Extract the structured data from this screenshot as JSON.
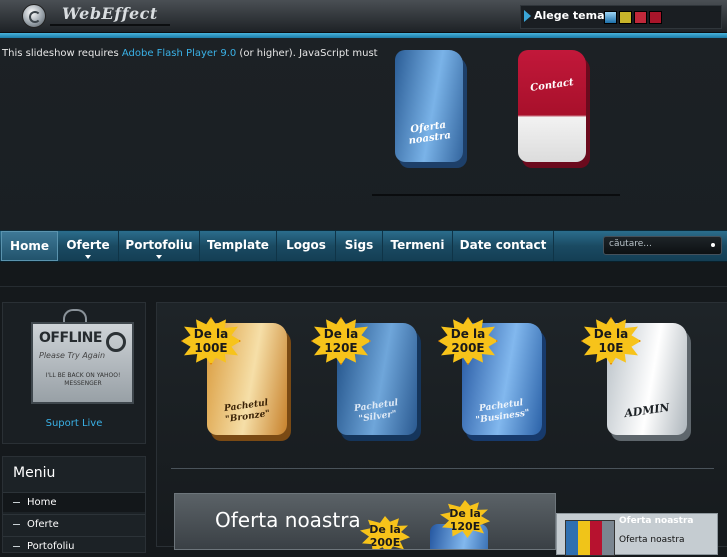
{
  "header": {
    "logo_text": "WebEffect",
    "theme_label": "Alege tema:",
    "theme_swatches": [
      {
        "name": "blue-theme",
        "color": "#2e7fb8"
      },
      {
        "name": "yellow-theme",
        "color": "#c8b42a"
      },
      {
        "name": "red-theme",
        "color": "#c0283a"
      },
      {
        "name": "crimson-theme",
        "color": "#a8152a"
      }
    ]
  },
  "hero": {
    "flash_text_before": "This slideshow requires ",
    "flash_link": "Adobe Flash Player 9.0",
    "flash_text_after": " (or higher). JavaScript must",
    "boxes": [
      {
        "label": "Oferta noastra"
      },
      {
        "label": "Contact"
      }
    ]
  },
  "nav": {
    "items": [
      {
        "label": "Home",
        "active": true
      },
      {
        "label": "Oferte",
        "dropdown": true
      },
      {
        "label": "Portofoliu",
        "dropdown": true
      },
      {
        "label": "Template"
      },
      {
        "label": "Logos"
      },
      {
        "label": "Sigs"
      },
      {
        "label": "Termeni"
      },
      {
        "label": "Date contact"
      }
    ],
    "search_placeholder": "căutare..."
  },
  "sidebar": {
    "offline_title": "OFFLINE",
    "offline_sub": "Please Try Again",
    "offline_foot": "I'LL BE BACK ON YAHOO! MESSENGER",
    "support_link": "Suport Live",
    "menu_title": "Meniu",
    "menu_items": [
      {
        "label": "Home"
      },
      {
        "label": "Oferte"
      },
      {
        "label": "Portofoliu"
      }
    ]
  },
  "main": {
    "products": [
      {
        "price": "De la 100E",
        "name": "Pachetul \"Bronze\""
      },
      {
        "price": "De la 120E",
        "name": "Pachetul \"Silver\""
      },
      {
        "price": "De la 200E",
        "name": "Pachetul \"Business\""
      },
      {
        "price": "De la 10E",
        "name": "ADMIN"
      }
    ],
    "featured_title": "Oferta noastra",
    "featured_bursts": [
      "De la 200E",
      "De la 120E"
    ],
    "thumb_title": "Oferta noastra",
    "thumb_sub": "Oferta noastra"
  }
}
